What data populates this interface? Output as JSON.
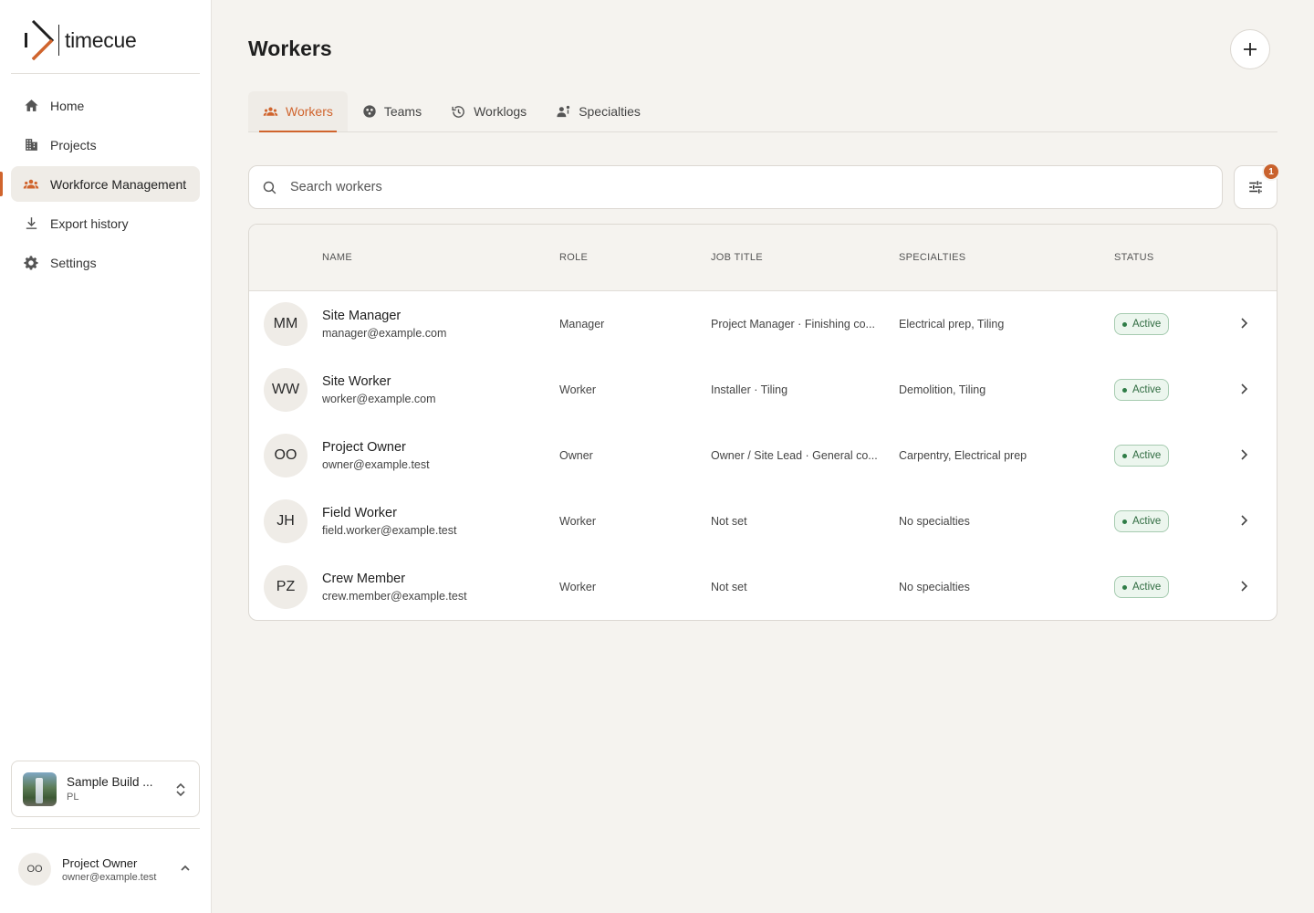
{
  "app": {
    "name": "timecue"
  },
  "sidebar": {
    "items": [
      {
        "label": "Home",
        "icon": "home-icon",
        "active": false
      },
      {
        "label": "Projects",
        "icon": "building-icon",
        "active": false
      },
      {
        "label": "Workforce Management",
        "icon": "people-icon",
        "active": true
      },
      {
        "label": "Export history",
        "icon": "download-icon",
        "active": false
      },
      {
        "label": "Settings",
        "icon": "gear-icon",
        "active": false
      }
    ],
    "project": {
      "name": "Sample Build ...",
      "country": "PL"
    },
    "user": {
      "initials": "OO",
      "name": "Project Owner",
      "email": "owner@example.test"
    }
  },
  "header": {
    "title": "Workers"
  },
  "tabs": [
    {
      "label": "Workers",
      "icon": "people-icon",
      "active": true
    },
    {
      "label": "Teams",
      "icon": "teams-icon",
      "active": false
    },
    {
      "label": "Worklogs",
      "icon": "history-icon",
      "active": false
    },
    {
      "label": "Specialties",
      "icon": "specialty-icon",
      "active": false
    }
  ],
  "search": {
    "placeholder": "Search workers",
    "value": ""
  },
  "filter": {
    "badge": "1"
  },
  "table": {
    "headers": {
      "name": "NAME",
      "role": "ROLE",
      "job_title": "JOB TITLE",
      "specialties": "SPECIALTIES",
      "status": "STATUS"
    },
    "rows": [
      {
        "initials": "MM",
        "name": "Site Manager",
        "email": "manager@example.com",
        "role": "Manager",
        "job_title": "Project Manager · Finishing co...",
        "specialties": "Electrical prep, Tiling",
        "status": "Active"
      },
      {
        "initials": "WW",
        "name": "Site Worker",
        "email": "worker@example.com",
        "role": "Worker",
        "job_title": "Installer · Tiling",
        "specialties": "Demolition, Tiling",
        "status": "Active"
      },
      {
        "initials": "OO",
        "name": "Project Owner",
        "email": "owner@example.test",
        "role": "Owner",
        "job_title": "Owner / Site Lead · General co...",
        "specialties": "Carpentry, Electrical prep",
        "status": "Active"
      },
      {
        "initials": "JH",
        "name": "Field Worker",
        "email": "field.worker@example.test",
        "role": "Worker",
        "job_title": "Not set",
        "specialties": "No specialties",
        "status": "Active"
      },
      {
        "initials": "PZ",
        "name": "Crew Member",
        "email": "crew.member@example.test",
        "role": "Worker",
        "job_title": "Not set",
        "specialties": "No specialties",
        "status": "Active"
      }
    ]
  },
  "colors": {
    "accent": "#d0642d",
    "status_active": "#2f7d47",
    "background": "#f5f3ef"
  }
}
